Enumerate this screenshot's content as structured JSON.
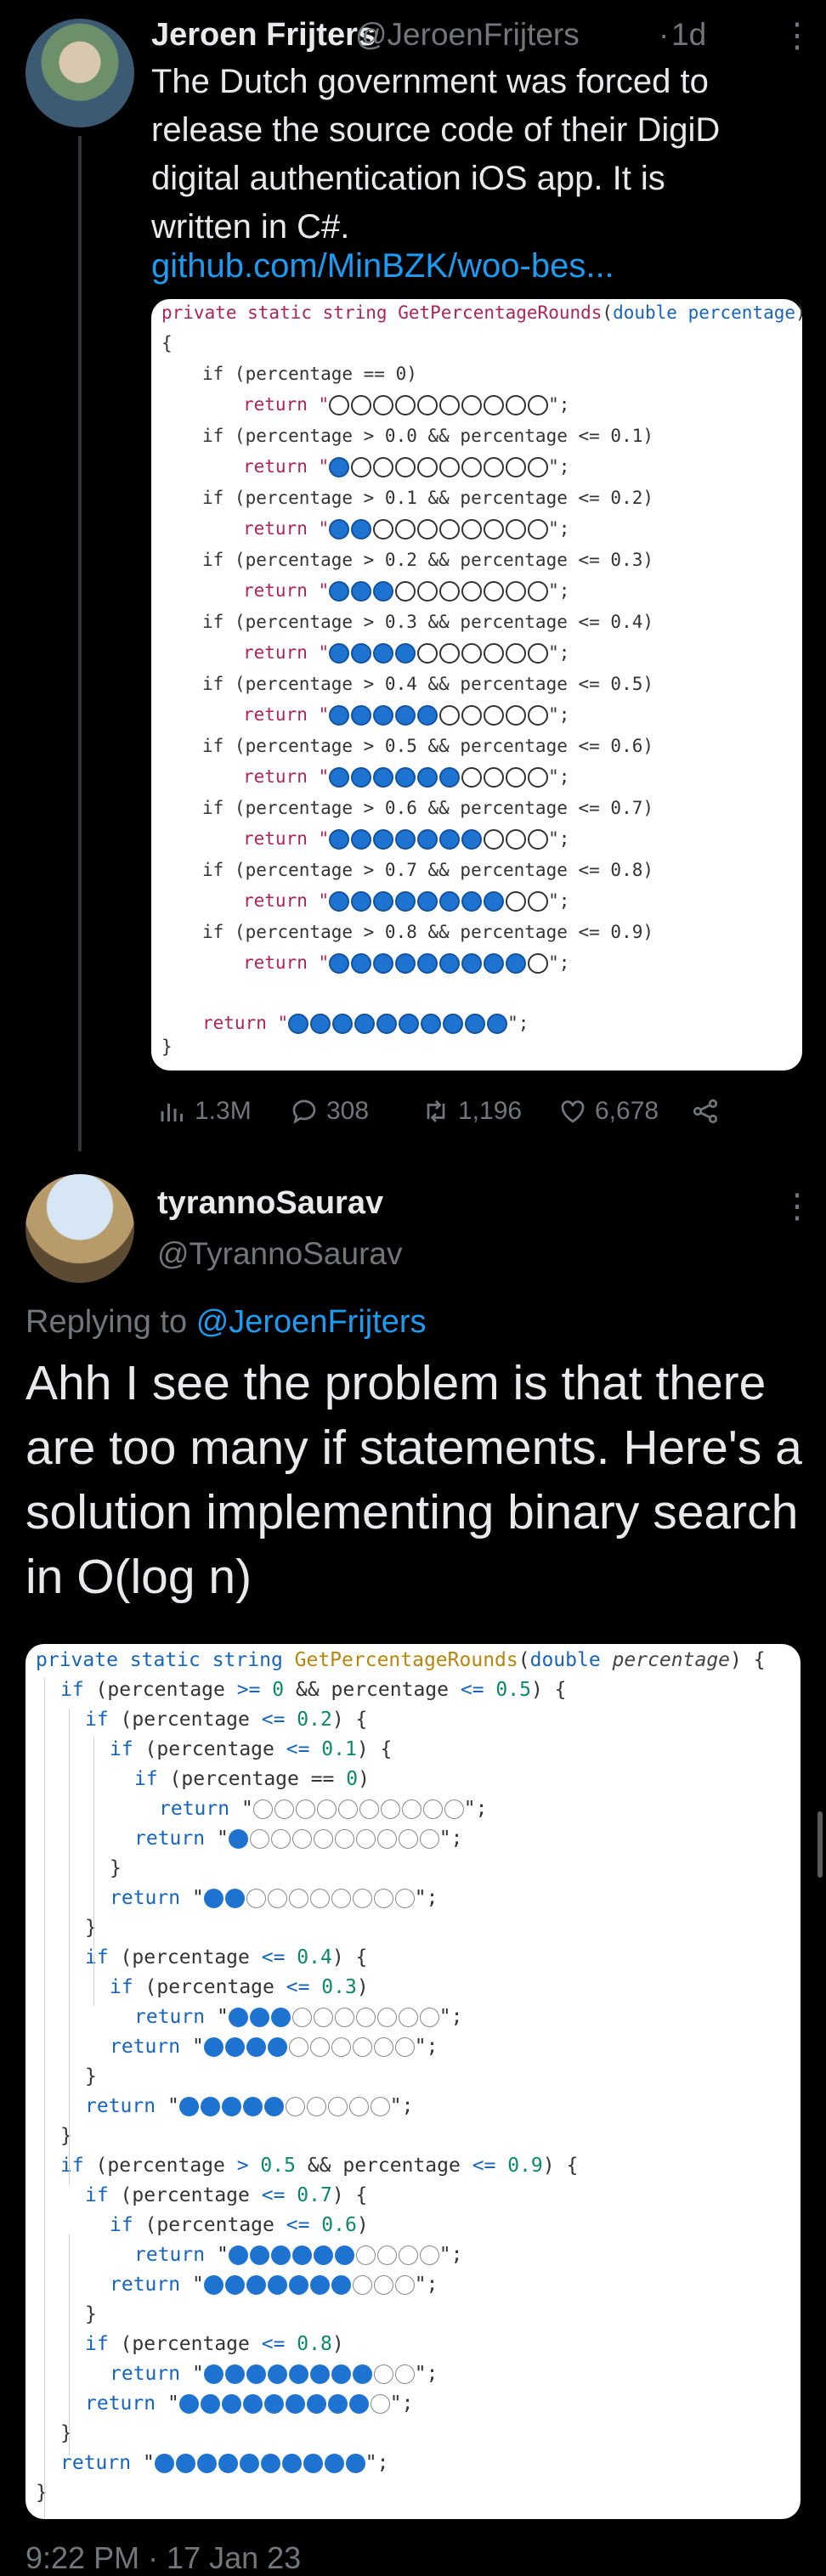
{
  "tweet": {
    "author_name": "Jeroen Frijters",
    "handle": "@JeroenFrijters",
    "separator": "·",
    "time": "1d",
    "more": "⋮",
    "text": "The Dutch government was forced to release the source code of their DigiD digital authentication iOS app. It is written in C#.",
    "link": "github.com/MinBZK/woo-bes...",
    "code": {
      "signature": {
        "kw1": "private static",
        "type": "string",
        "name": "GetPercentageRounds",
        "param_type": "double",
        "param": "percentage"
      },
      "open_brace": "{",
      "close_brace": "}",
      "blocks": [
        {
          "cond": "if (percentage == 0)",
          "filled": 0
        },
        {
          "cond": "if (percentage > 0.0 && percentage <= 0.1)",
          "filled": 1
        },
        {
          "cond": "if (percentage > 0.1 && percentage <= 0.2)",
          "filled": 2
        },
        {
          "cond": "if (percentage > 0.2 && percentage <= 0.3)",
          "filled": 3
        },
        {
          "cond": "if (percentage > 0.3 && percentage <= 0.4)",
          "filled": 4
        },
        {
          "cond": "if (percentage > 0.4 && percentage <= 0.5)",
          "filled": 5
        },
        {
          "cond": "if (percentage > 0.5 && percentage <= 0.6)",
          "filled": 6
        },
        {
          "cond": "if (percentage > 0.6 && percentage <= 0.7)",
          "filled": 7
        },
        {
          "cond": "if (percentage > 0.7 && percentage <= 0.8)",
          "filled": 8
        },
        {
          "cond": "if (percentage > 0.8 && percentage <= 0.9)",
          "filled": 9
        }
      ],
      "final_filled": 10,
      "return_kw": "return",
      "quote": "\"",
      "end": "\";"
    },
    "stats": {
      "views": "1.3M",
      "replies": "308",
      "retweets": "1,196",
      "likes": "6,678"
    }
  },
  "reply": {
    "author_name": "tyrannoSaurav",
    "handle": "@TyrannoSaurav",
    "more": "⋮",
    "replying_prefix": "Replying to",
    "replying_to": "@JeroenFrijters",
    "text": "Ahh I see the problem is that there are too many if statements. Here's a solution implementing binary search in O(log n)",
    "timestamp": "9:22 PM · 17 Jan 23"
  },
  "colors": {
    "background": "#000000",
    "link": "#1d9bf0",
    "muted": "#71767b",
    "round_filled": "#1e73d1"
  }
}
